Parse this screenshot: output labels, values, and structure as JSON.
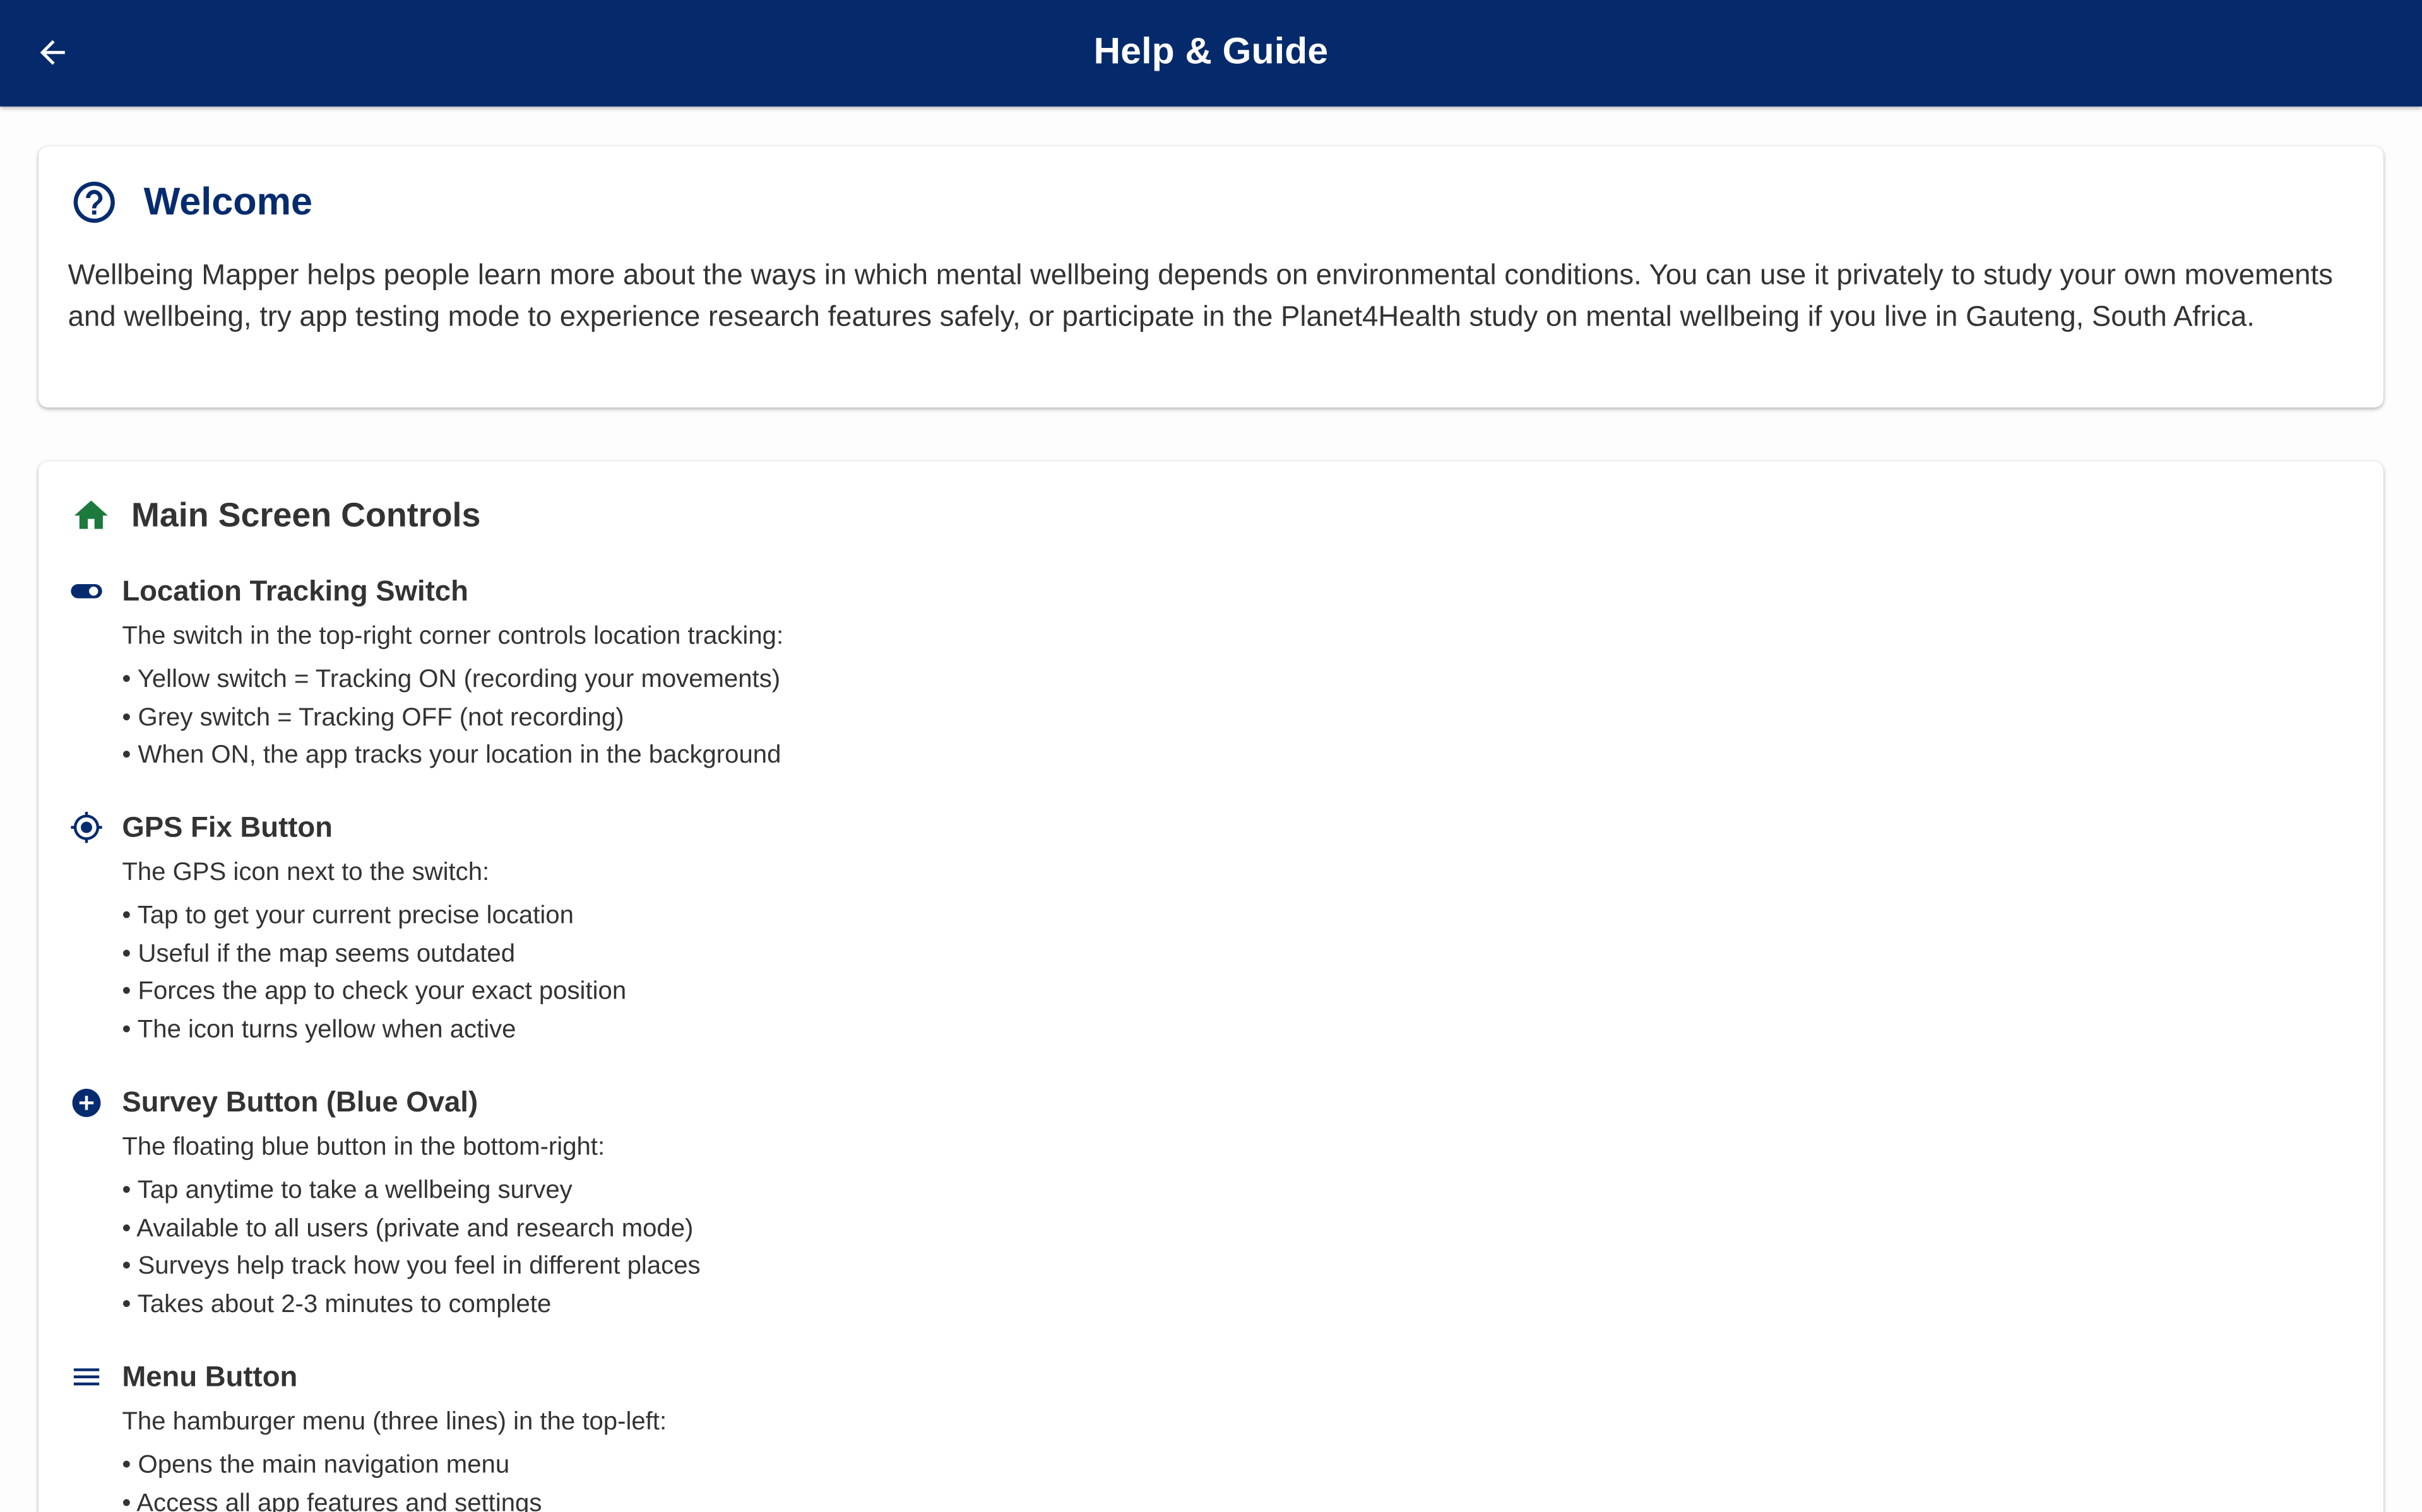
{
  "appbar": {
    "title": "Help & Guide",
    "back_icon": "arrow-back-icon",
    "background": "#052a6b"
  },
  "welcome": {
    "icon": "help-circle-icon",
    "title": "Welcome",
    "text": "Wellbeing Mapper helps people learn more about the ways in which mental wellbeing depends on environmental conditions. You can use it privately to study your own movements and wellbeing, try app testing mode to experience research features safely, or participate in the Planet4Health study on mental wellbeing if you live in Gauteng, South Africa."
  },
  "controls": {
    "icon": "home-icon",
    "title": "Main Screen Controls",
    "items": [
      {
        "icon": "toggle-icon",
        "title": "Location Tracking Switch",
        "description": "The switch in the top-right corner controls location tracking:",
        "bullets": [
          "• Yellow switch = Tracking ON (recording your movements)",
          "• Grey switch = Tracking OFF (not recording)",
          "• When ON, the app tracks your location in the background"
        ]
      },
      {
        "icon": "gps-fixed-icon",
        "title": "GPS Fix Button",
        "description": "The GPS icon next to the switch:",
        "bullets": [
          "• Tap to get your current precise location",
          "• Useful if the map seems outdated",
          "• Forces the app to check your exact position",
          "• The icon turns yellow when active"
        ]
      },
      {
        "icon": "add-circle-icon",
        "title": "Survey Button (Blue Oval)",
        "description": "The floating blue button in the bottom-right:",
        "bullets": [
          "• Tap anytime to take a wellbeing survey",
          "• Available to all users (private and research mode)",
          "• Surveys help track how you feel in different places",
          "• Takes about 2-3 minutes to complete"
        ]
      },
      {
        "icon": "menu-icon",
        "title": "Menu Button",
        "description": "The hamburger menu (three lines) in the top-left:",
        "bullets": [
          "• Opens the main navigation menu",
          "• Access all app features and settings"
        ]
      }
    ]
  },
  "colors": {
    "primary": "#052a6b",
    "heading_blue": "#062b6f",
    "home_green": "#1b7a3c",
    "text": "#333333"
  }
}
